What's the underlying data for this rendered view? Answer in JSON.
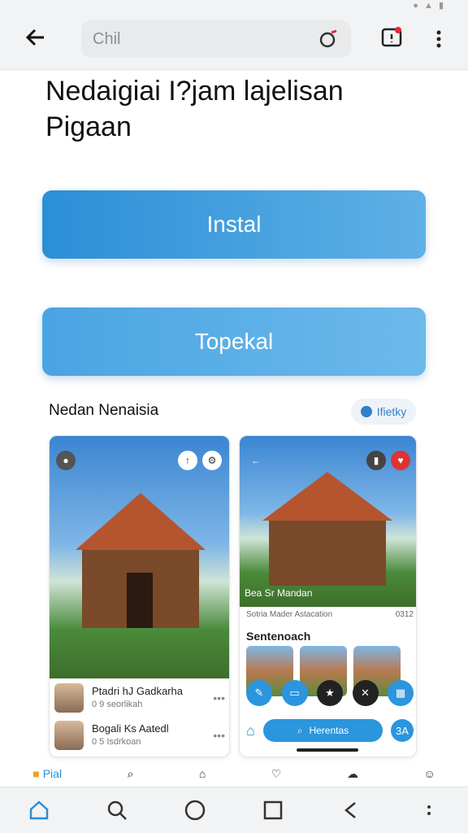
{
  "toolbar": {
    "search_text": "Chil"
  },
  "page": {
    "title": "Nedaigiai I?jam lajelisan\nPigaan"
  },
  "buttons": {
    "install": "Instal",
    "topekal": "Topekal"
  },
  "section": {
    "title": "Nedan Nenaisia",
    "chip": "Ifietky"
  },
  "card_left": {
    "rows": [
      {
        "title": "Ptadri hJ Gadkarha",
        "sub": "0 9 seorlikah"
      },
      {
        "title": "Bogali Ks Aatedl",
        "sub": "0 5 Isdrkoan"
      }
    ]
  },
  "card_right": {
    "caption": "Bea Sr Mandan",
    "info_left": "Sotria Mader Astacation",
    "info_right": "0312",
    "title": "Sentenoach",
    "search_pill": "Herentas",
    "badge": "3A"
  },
  "bottom_tabs": {
    "first": "Pial"
  },
  "colors": {
    "primary": "#2b8fd6",
    "accent": "#5fb0e6"
  }
}
